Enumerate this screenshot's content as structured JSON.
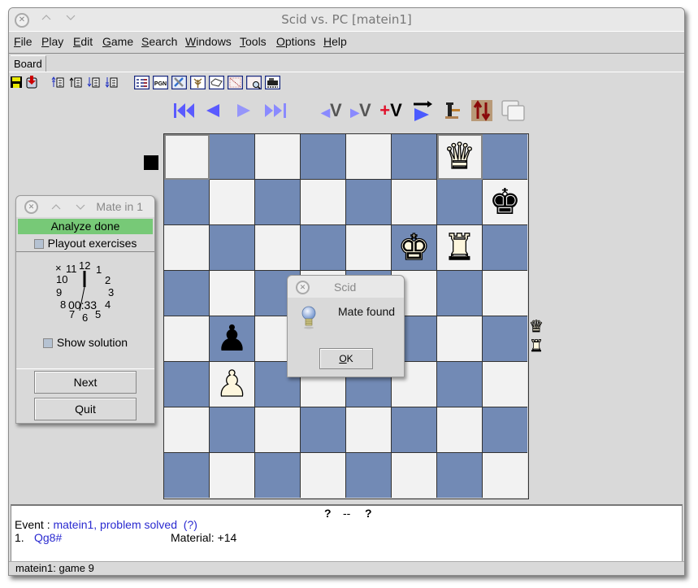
{
  "window": {
    "title": "Scid vs. PC [matein1]",
    "close_glyph": "✕",
    "minimize_glyph": "︿",
    "maximize_glyph": "﹀"
  },
  "menu": [
    {
      "label": "File",
      "key": "F",
      "rest": "ile"
    },
    {
      "label": "Play",
      "key": "P",
      "rest": "lay"
    },
    {
      "label": "Edit",
      "key": "E",
      "rest": "dit"
    },
    {
      "label": "Game",
      "key": "G",
      "rest": "ame"
    },
    {
      "label": "Search",
      "key": "S",
      "rest": "earch"
    },
    {
      "label": "Windows",
      "key": "W",
      "rest": "indows"
    },
    {
      "label": "Tools",
      "key": "T",
      "rest": "ools"
    },
    {
      "label": "Options",
      "key": "O",
      "rest": "ptions"
    },
    {
      "label": "Help",
      "key": "H",
      "rest": "elp"
    }
  ],
  "tabs": [
    {
      "label": "Board"
    }
  ],
  "toolbar": {
    "icons": [
      "save-icon",
      "save-as-icon",
      "first-game-icon",
      "previous-game-icon",
      "next-game-icon",
      "last-game-icon",
      "gamelist-icon",
      "pgn-icon",
      "tools-icon",
      "tree-icon",
      "book-icon",
      "crosstable-icon",
      "search-icon",
      "engine-icon"
    ],
    "pgn_label": "PGN"
  },
  "navigation": {
    "start": "⏮",
    "back": "◀",
    "forward": "▶",
    "end": "⏭",
    "var_back": "◂V",
    "var_forward": "▸V",
    "add_var": "+V",
    "add_var_plus": "+",
    "add_var_v": "V"
  },
  "board": {
    "light_color": "#f2f2f2",
    "dark_color": "#728ab5",
    "side_to_move": "black",
    "highlighted_squares": [
      "a8",
      "g8"
    ],
    "pieces": [
      {
        "square": "g8",
        "piece": "♛",
        "color": "white",
        "name": "white-queen"
      },
      {
        "square": "h7",
        "piece": "♚",
        "color": "black",
        "name": "black-king"
      },
      {
        "square": "f6",
        "piece": "♚",
        "color": "white",
        "name": "white-king"
      },
      {
        "square": "g6",
        "piece": "♜",
        "color": "white",
        "name": "white-rook"
      },
      {
        "square": "b4",
        "piece": "♟",
        "color": "black",
        "name": "black-pawn"
      },
      {
        "square": "b3",
        "piece": "♟",
        "color": "white",
        "name": "white-pawn"
      }
    ],
    "material_diff": [
      "♛",
      "♜"
    ]
  },
  "info": {
    "result_left": "?",
    "result_sep": "--",
    "result_right": "?",
    "event_label": "Event : ",
    "event_value": "matein1, problem solved",
    "event_extra": "(?)",
    "move_number": "1.",
    "move": "Qg8#",
    "material": "Material: +14"
  },
  "status": "matein1: game  9",
  "mate_window": {
    "title": "Mate in 1",
    "analyze_status": "Analyze done",
    "analyze_color": "#77c977",
    "playout_label": "Playout exercises",
    "clock_numbers": [
      "12",
      "1",
      "2",
      "3",
      "4",
      "5",
      "6",
      "7",
      "8",
      "9",
      "10",
      "11"
    ],
    "clock_time": "00:33",
    "clock_close": "×",
    "show_solution_label": "Show solution",
    "next_label": "Next",
    "quit_label": "Quit"
  },
  "dialog": {
    "title": "Scid",
    "message": "Mate found",
    "ok_label": "OK",
    "ok_key": "O",
    "ok_rest": "K"
  }
}
